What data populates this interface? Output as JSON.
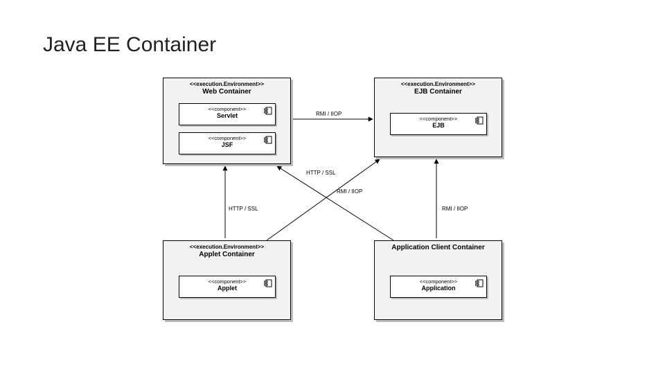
{
  "title": "Java EE Container",
  "containers": {
    "web": {
      "stereotype": "<<execution.Environment>>",
      "name": "Web Container",
      "components": {
        "servlet": {
          "stereotype": "<<component>>",
          "name": "Servlet"
        },
        "jsf": {
          "stereotype": "<<component>>",
          "name": "JSF"
        }
      }
    },
    "ejb": {
      "stereotype": "<<execution.Environment>>",
      "name": "EJB Container",
      "components": {
        "ejb": {
          "stereotype": "<<component>>",
          "name": "EJB"
        }
      }
    },
    "applet": {
      "stereotype": "<<execution.Environment>>",
      "name": "Applet Container",
      "components": {
        "applet": {
          "stereotype": "<<component>>",
          "name": "Applet"
        }
      }
    },
    "appclient": {
      "name": "Application Client Container",
      "components": {
        "application": {
          "stereotype": "<<component>>",
          "name": "Application"
        }
      }
    }
  },
  "edges": {
    "web_to_ejb": "RMI / IIOP",
    "applet_to_web": "HTTP / SSL",
    "appclient_to_web": "HTTP / SSL",
    "applet_to_ejb": "RMI / IIOP",
    "appclient_to_ejb": "RMI / IIOP"
  }
}
